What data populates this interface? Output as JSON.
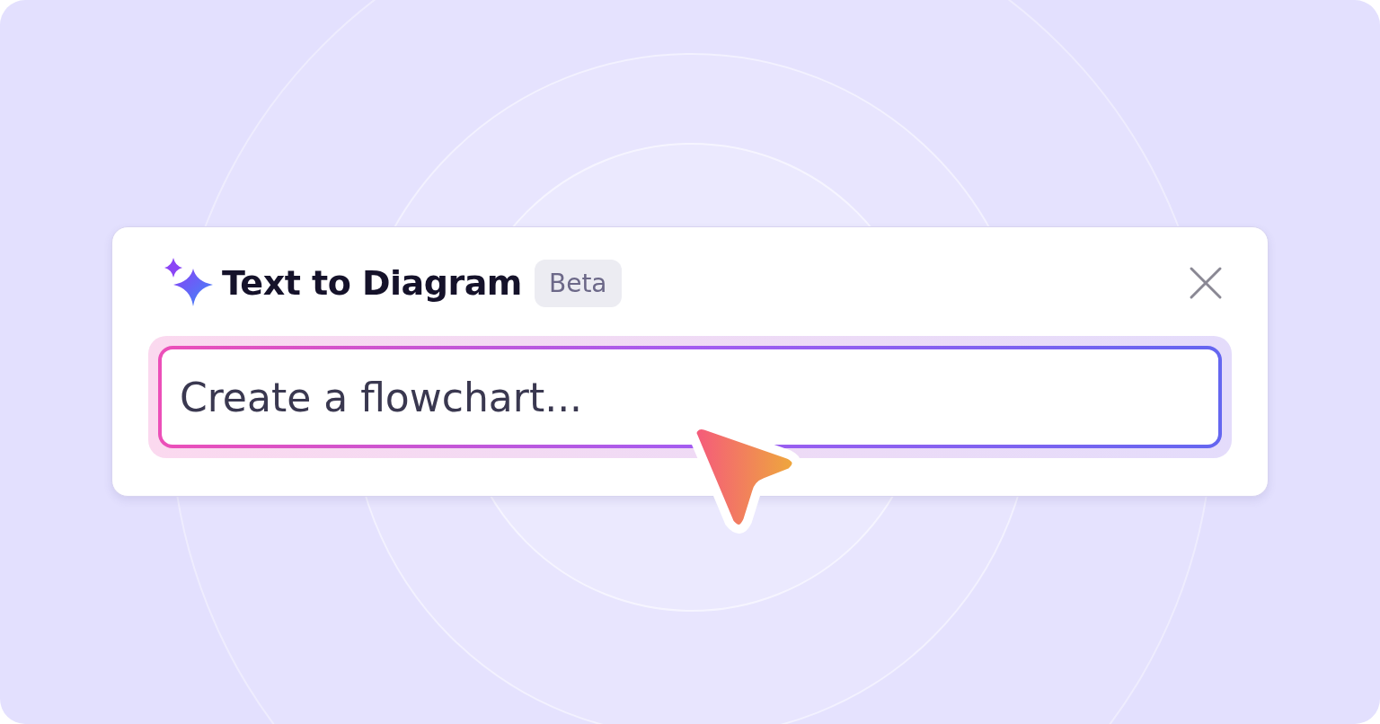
{
  "dialog": {
    "title": "Text to Diagram",
    "badge": "Beta"
  },
  "prompt": {
    "placeholder": "Create a flowchart..."
  }
}
